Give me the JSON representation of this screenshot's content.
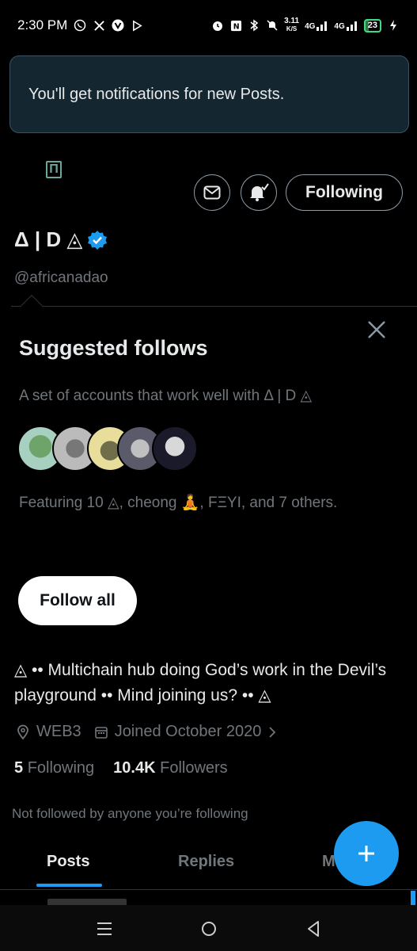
{
  "status_bar": {
    "time": "2:30 PM",
    "net_speed": "3.11",
    "net_unit": "K/S",
    "net_type_1": "4G",
    "net_type_2": "4G",
    "battery": "23"
  },
  "toast": {
    "text": "You'll get notifications for new Posts."
  },
  "profile": {
    "display_name": "Δ | D ◬",
    "handle": "@africanadao",
    "following_button": "Following"
  },
  "suggested": {
    "title": "Suggested follows",
    "subtitle": "A set of accounts that work well with Δ | D ◬",
    "featuring": "Featuring 10 ◬, cheong 🧘, FΞYI, and 7 others.",
    "follow_all": "Follow all"
  },
  "bio": {
    "text": "◬ •• Multichain hub doing God’s work in the Devil’s playground •• Mind joining us? •• ◬",
    "location": "WEB3",
    "joined": "Joined October 2020"
  },
  "stats": {
    "following_count": "5",
    "following_label": "Following",
    "followers_count": "10.4K",
    "followers_label": "Followers"
  },
  "not_followed": "Not followed by anyone you’re following",
  "tabs": [
    "Posts",
    "Replies",
    "M"
  ],
  "colors": {
    "accent": "#1d9bf0",
    "background": "#000000",
    "muted": "#71767b",
    "toast_bg": "#142630"
  }
}
